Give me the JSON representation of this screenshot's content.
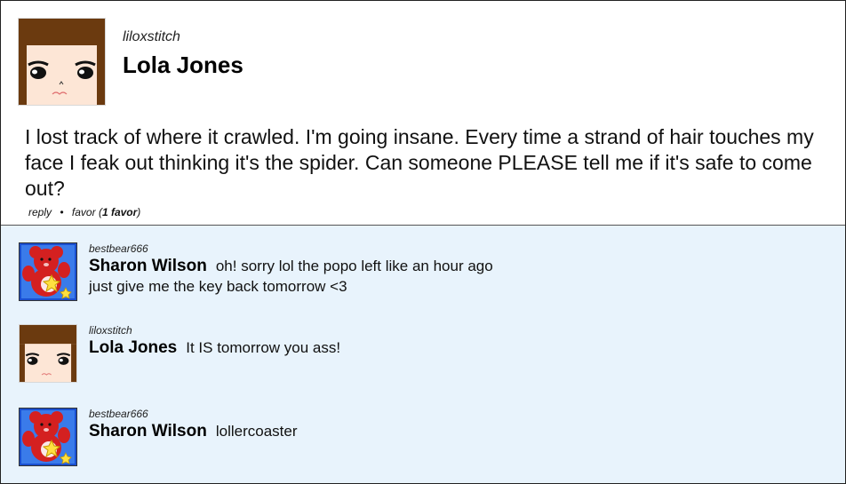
{
  "post": {
    "username": "liloxstitch",
    "display_name": "Lola Jones",
    "body": "I lost track of where it crawled. I'm going insane. Every time a strand of hair touches my face I feak out thinking it's the spider. Can someone PLEASE tell me if it's safe to come out?",
    "actions": {
      "reply_label": "reply",
      "separator": "•",
      "favor_label": "favor",
      "favor_count_open": "(",
      "favor_count": "1 favor",
      "favor_count_close": ")"
    },
    "avatar": "anime-girl-face-icon"
  },
  "replies": [
    {
      "username": "bestbear666",
      "display_name": "Sharon Wilson",
      "text_line1": "oh! sorry lol the popo left like an hour ago",
      "text_line2": "just give me the key back tomorrow <3",
      "avatar": "red-care-bear-icon"
    },
    {
      "username": "liloxstitch",
      "display_name": "Lola Jones",
      "text_line1": "It IS tomorrow you ass!",
      "avatar": "anime-girl-face-icon"
    },
    {
      "username": "bestbear666",
      "display_name": "Sharon Wilson",
      "text_line1": "lollercoaster",
      "avatar": "red-care-bear-icon"
    }
  ],
  "colors": {
    "replies_background": "#e8f3fc",
    "hair_brown": "#6b3a0f",
    "skin": "#fde6d6",
    "bear_red": "#d42020",
    "bear_bg_blue": "#1a4fd0"
  }
}
